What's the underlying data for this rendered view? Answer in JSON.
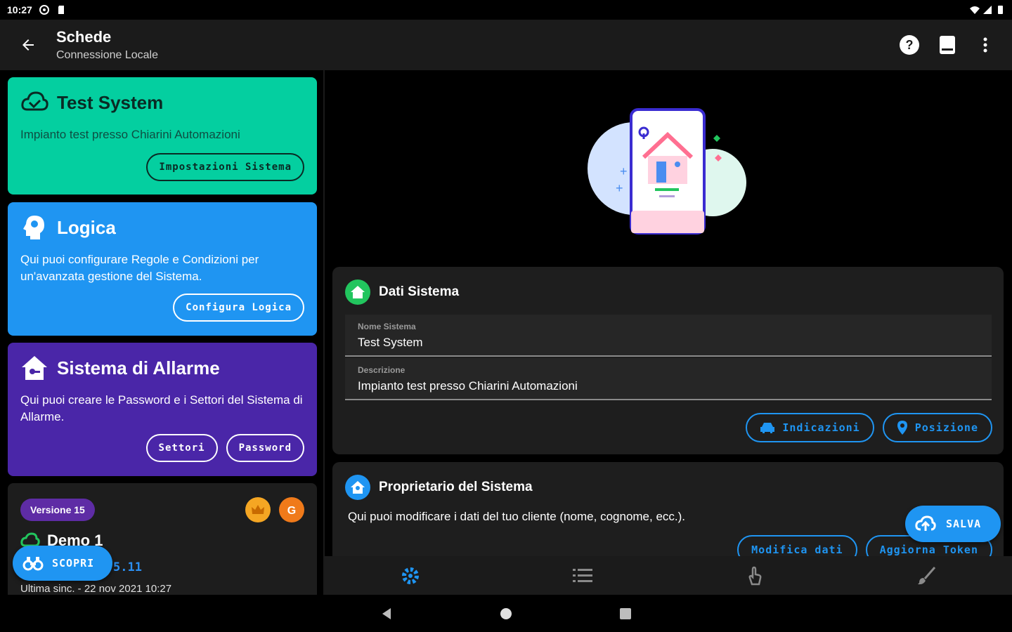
{
  "status_bar": {
    "time": "10:27"
  },
  "app_bar": {
    "title": "Schede",
    "subtitle": "Connessione Locale"
  },
  "cards": {
    "test_system": {
      "title": "Test System",
      "description": "Impianto test presso Chiarini Automazioni",
      "button": "Impostazioni Sistema",
      "color": "#04cfa0"
    },
    "logica": {
      "title": "Logica",
      "description": "Qui puoi configurare Regole e Condizioni per un'avanzata gestione del Sistema.",
      "button": "Configura Logica",
      "color": "#1f95f2"
    },
    "allarme": {
      "title": "Sistema di Allarme",
      "description": "Qui puoi creare le Password e i Settori del Sistema di Allarme.",
      "buttons": [
        "Settori",
        "Password"
      ],
      "color": "#4a26a8"
    },
    "demo": {
      "version": "Versione 15",
      "name": "Demo 1",
      "ip_partial": "5.11",
      "last_sync": "Ultima sinc. - 22 nov 2021 10:27"
    }
  },
  "fab_scopri": {
    "label": "SCOPRI"
  },
  "dati_sistema": {
    "title": "Dati Sistema",
    "fields": [
      {
        "label": "Nome Sistema",
        "value": "Test System"
      },
      {
        "label": "Descrizione",
        "value": "Impianto test presso Chiarini Automazioni"
      }
    ],
    "buttons": [
      "Indicazioni",
      "Posizione"
    ]
  },
  "proprietario": {
    "title": "Proprietario del Sistema",
    "description": "Qui puoi modificare i dati del tuo cliente (nome, cognome, ecc.).",
    "buttons": [
      "Modifica dati",
      "Aggiorna Token"
    ]
  },
  "fab_salva": {
    "label": "SALVA"
  },
  "bottom_nav": [
    "settings-icon",
    "list-icon",
    "touch-icon",
    "brush-icon"
  ],
  "colors": {
    "accent": "#1f95f2",
    "teal": "#04cfa0",
    "purple": "#4a26a8",
    "green": "#22c55e",
    "orange": "#f5a623"
  }
}
